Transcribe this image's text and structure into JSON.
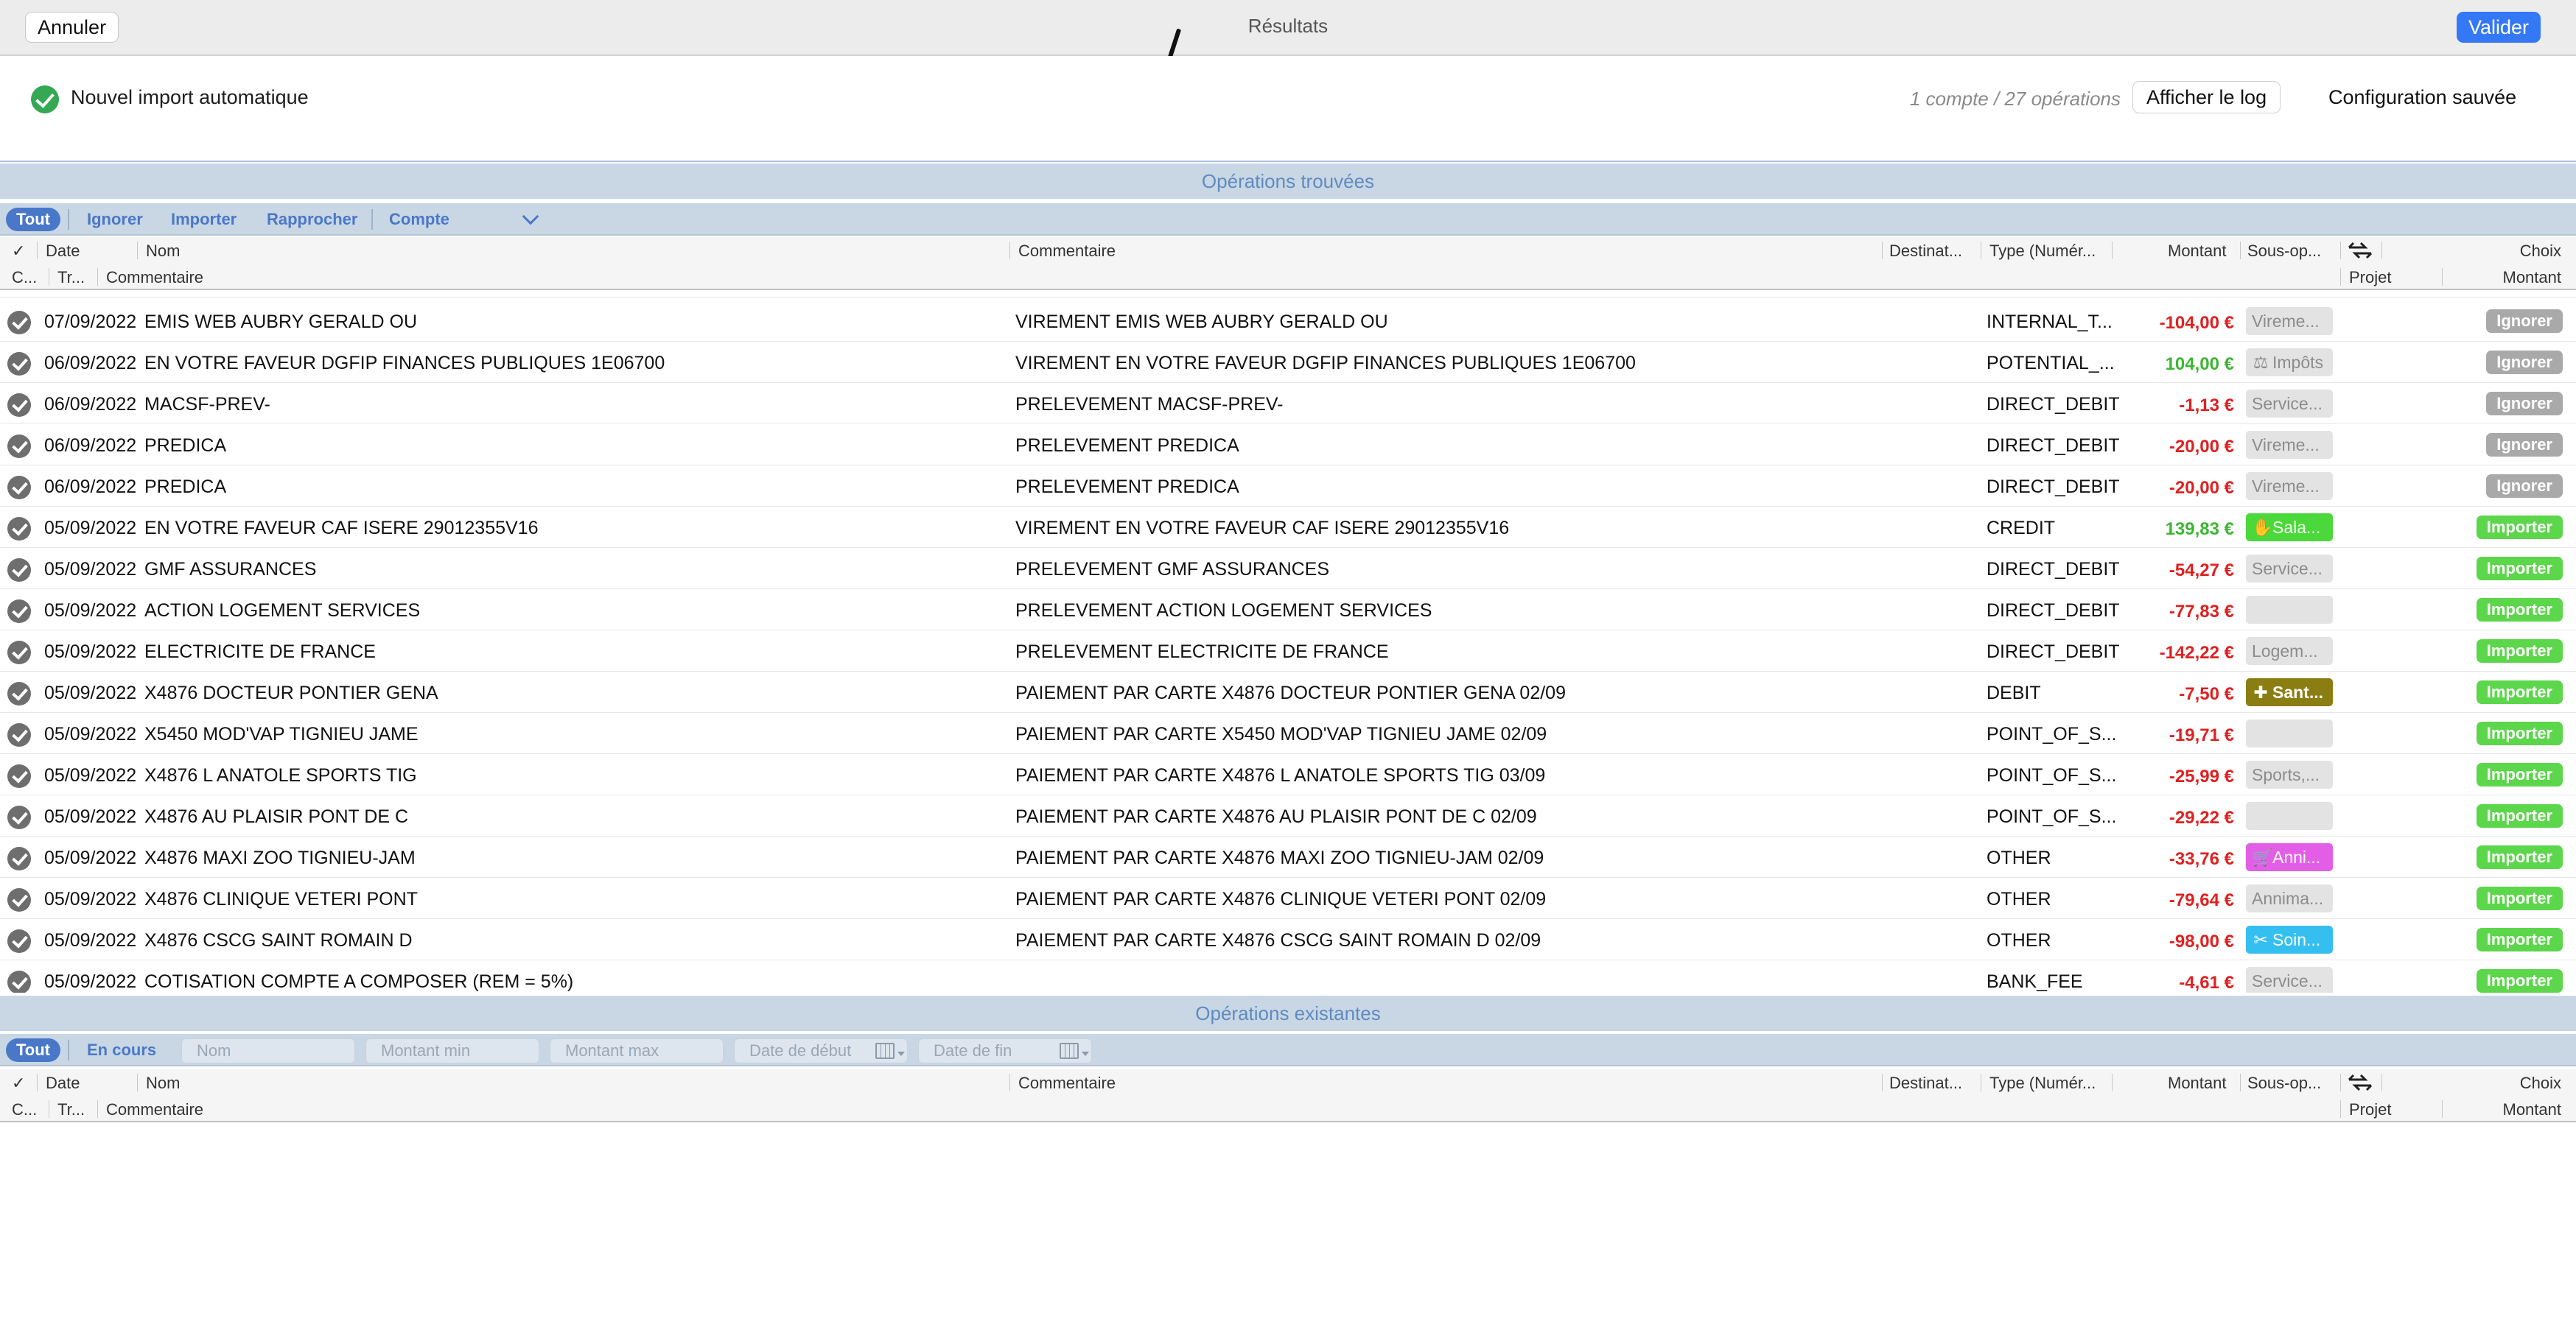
{
  "window": {
    "title": "Résultats",
    "cancel_label": "Annuler",
    "validate_label": "Valider"
  },
  "status": {
    "import_label": "Nouvel import automatique",
    "counts": "1 compte / 27 opérations",
    "log_button": "Afficher le log",
    "config_saved": "Configuration sauvée"
  },
  "found": {
    "section_title": "Opérations trouvées",
    "filters": {
      "all": "Tout",
      "ignore": "Ignorer",
      "import": "Importer",
      "reconcile": "Rapprocher",
      "account": "Compte"
    }
  },
  "columns": {
    "row1": {
      "check": "✓",
      "date": "Date",
      "name": "Nom",
      "comment": "Commentaire",
      "destination": "Destinat...",
      "type": "Type (Numér...",
      "amount": "Montant",
      "subop": "Sous-op...",
      "choice": "Choix"
    },
    "row2": {
      "c": "C...",
      "tr": "Tr...",
      "comment": "Commentaire",
      "project": "Projet",
      "amount": "Montant"
    }
  },
  "rows": [
    {
      "date": "07/09/2022",
      "name": "EMIS WEB AUBRY GERALD OU",
      "comment": "VIREMENT EMIS WEB AUBRY GERALD OU",
      "type": "INTERNAL_T...",
      "amount": "-104,00 €",
      "sign": "neg",
      "subop": "Vireme...",
      "subop_style": "plainbox",
      "subop_icon": "",
      "action": "Ignorer",
      "action_style": "ignore"
    },
    {
      "date": "06/09/2022",
      "name": "EN VOTRE FAVEUR DGFIP FINANCES PUBLIQUES 1E06700",
      "comment": "VIREMENT EN VOTRE FAVEUR DGFIP FINANCES PUBLIQUES 1E06700",
      "type": "POTENTIAL_...",
      "amount": "104,00 €",
      "sign": "pos",
      "subop": "Impôts",
      "subop_style": "plainbox",
      "subop_icon": "⚖",
      "action": "Ignorer",
      "action_style": "ignore"
    },
    {
      "date": "06/09/2022",
      "name": "MACSF-PREV-",
      "comment": "PRELEVEMENT MACSF-PREV-",
      "type": "DIRECT_DEBIT",
      "amount": "-1,13 €",
      "sign": "neg",
      "subop": "Service...",
      "subop_style": "plainbox",
      "subop_icon": "",
      "action": "Ignorer",
      "action_style": "ignore"
    },
    {
      "date": "06/09/2022",
      "name": "PREDICA",
      "comment": "PRELEVEMENT PREDICA",
      "type": "DIRECT_DEBIT",
      "amount": "-20,00 €",
      "sign": "neg",
      "subop": "Vireme...",
      "subop_style": "plainbox",
      "subop_icon": "",
      "action": "Ignorer",
      "action_style": "ignore"
    },
    {
      "date": "06/09/2022",
      "name": "PREDICA",
      "comment": "PRELEVEMENT PREDICA",
      "type": "DIRECT_DEBIT",
      "amount": "-20,00 €",
      "sign": "neg",
      "subop": "Vireme...",
      "subop_style": "plainbox",
      "subop_icon": "",
      "action": "Ignorer",
      "action_style": "ignore"
    },
    {
      "date": "05/09/2022",
      "name": "EN VOTRE FAVEUR CAF ISERE 29012355V16",
      "comment": "VIREMENT EN VOTRE FAVEUR CAF ISERE 29012355V16",
      "type": "CREDIT",
      "amount": "139,83 €",
      "sign": "pos",
      "subop": "Sala...",
      "subop_style": "green",
      "subop_icon": "✋",
      "action": "Importer",
      "action_style": "import"
    },
    {
      "date": "05/09/2022",
      "name": "GMF ASSURANCES",
      "comment": "PRELEVEMENT GMF ASSURANCES",
      "type": "DIRECT_DEBIT",
      "amount": "-54,27 €",
      "sign": "neg",
      "subop": "Service...",
      "subop_style": "plainbox",
      "subop_icon": "",
      "action": "Importer",
      "action_style": "import"
    },
    {
      "date": "05/09/2022",
      "name": "ACTION LOGEMENT SERVICES",
      "comment": "PRELEVEMENT ACTION LOGEMENT SERVICES",
      "type": "DIRECT_DEBIT",
      "amount": "-77,83 €",
      "sign": "neg",
      "subop": "",
      "subop_style": "plainbox",
      "subop_icon": "",
      "action": "Importer",
      "action_style": "import"
    },
    {
      "date": "05/09/2022",
      "name": "ELECTRICITE DE FRANCE",
      "comment": "PRELEVEMENT ELECTRICITE DE FRANCE",
      "type": "DIRECT_DEBIT",
      "amount": "-142,22 €",
      "sign": "neg",
      "subop": "Logem...",
      "subop_style": "plainbox",
      "subop_icon": "",
      "action": "Importer",
      "action_style": "import"
    },
    {
      "date": "05/09/2022",
      "name": "X4876 DOCTEUR PONTIER GENA",
      "comment": "PAIEMENT PAR CARTE X4876 DOCTEUR PONTIER GENA 02/09",
      "type": "DEBIT",
      "amount": "-7,50 €",
      "sign": "neg",
      "subop": "Sant...",
      "subop_style": "olive",
      "subop_icon": "✚",
      "action": "Importer",
      "action_style": "import"
    },
    {
      "date": "05/09/2022",
      "name": "X5450 MOD'VAP TIGNIEU JAME",
      "comment": "PAIEMENT PAR CARTE X5450 MOD'VAP TIGNIEU JAME 02/09",
      "type": "POINT_OF_S...",
      "amount": "-19,71 €",
      "sign": "neg",
      "subop": "",
      "subop_style": "plainbox",
      "subop_icon": "",
      "action": "Importer",
      "action_style": "import"
    },
    {
      "date": "05/09/2022",
      "name": "X4876 L ANATOLE SPORTS TIG",
      "comment": "PAIEMENT PAR CARTE X4876 L ANATOLE SPORTS TIG 03/09",
      "type": "POINT_OF_S...",
      "amount": "-25,99 €",
      "sign": "neg",
      "subop": "Sports,...",
      "subop_style": "plainbox",
      "subop_icon": "",
      "action": "Importer",
      "action_style": "import"
    },
    {
      "date": "05/09/2022",
      "name": "X4876 AU PLAISIR PONT DE C",
      "comment": "PAIEMENT PAR CARTE X4876 AU PLAISIR PONT DE C 02/09",
      "type": "POINT_OF_S...",
      "amount": "-29,22 €",
      "sign": "neg",
      "subop": "",
      "subop_style": "plainbox",
      "subop_icon": "",
      "action": "Importer",
      "action_style": "import"
    },
    {
      "date": "05/09/2022",
      "name": "X4876 MAXI ZOO TIGNIEU-JAM",
      "comment": "PAIEMENT PAR CARTE X4876 MAXI ZOO TIGNIEU-JAM 02/09",
      "type": "OTHER",
      "amount": "-33,76 €",
      "sign": "neg",
      "subop": "Anni...",
      "subop_style": "pink",
      "subop_icon": "🛒",
      "action": "Importer",
      "action_style": "import"
    },
    {
      "date": "05/09/2022",
      "name": "X4876 CLINIQUE VETERI PONT",
      "comment": "PAIEMENT PAR CARTE X4876 CLINIQUE VETERI PONT 02/09",
      "type": "OTHER",
      "amount": "-79,64 €",
      "sign": "neg",
      "subop": "Annima...",
      "subop_style": "plainbox",
      "subop_icon": "",
      "action": "Importer",
      "action_style": "import"
    },
    {
      "date": "05/09/2022",
      "name": "X4876 CSCG SAINT ROMAIN D",
      "comment": "PAIEMENT PAR CARTE X4876 CSCG SAINT ROMAIN D 02/09",
      "type": "OTHER",
      "amount": "-98,00 €",
      "sign": "neg",
      "subop": "Soin...",
      "subop_style": "sky",
      "subop_icon": "✂",
      "action": "Importer",
      "action_style": "import"
    },
    {
      "date": "05/09/2022",
      "name": "COTISATION COMPTE A COMPOSER (REM = 5%)",
      "comment": "",
      "type": "BANK_FEE",
      "amount": "-4,61 €",
      "sign": "neg",
      "subop": "Service...",
      "subop_style": "plainbox",
      "subop_icon": "",
      "action": "Importer",
      "action_style": "import"
    }
  ],
  "existing": {
    "section_title": "Opérations existantes",
    "filters": {
      "all": "Tout",
      "in_progress": "En cours",
      "name_placeholder": "Nom",
      "min_placeholder": "Montant min",
      "max_placeholder": "Montant max",
      "start_placeholder": "Date de début",
      "end_placeholder": "Date de fin"
    }
  },
  "colors": {
    "accent": "#3478f6",
    "negative": "#e02020",
    "positive": "#3cb632",
    "section_bg": "#c9d7e5",
    "import_green": "#5cd64a",
    "ignore_gray": "#a9a9a9"
  }
}
